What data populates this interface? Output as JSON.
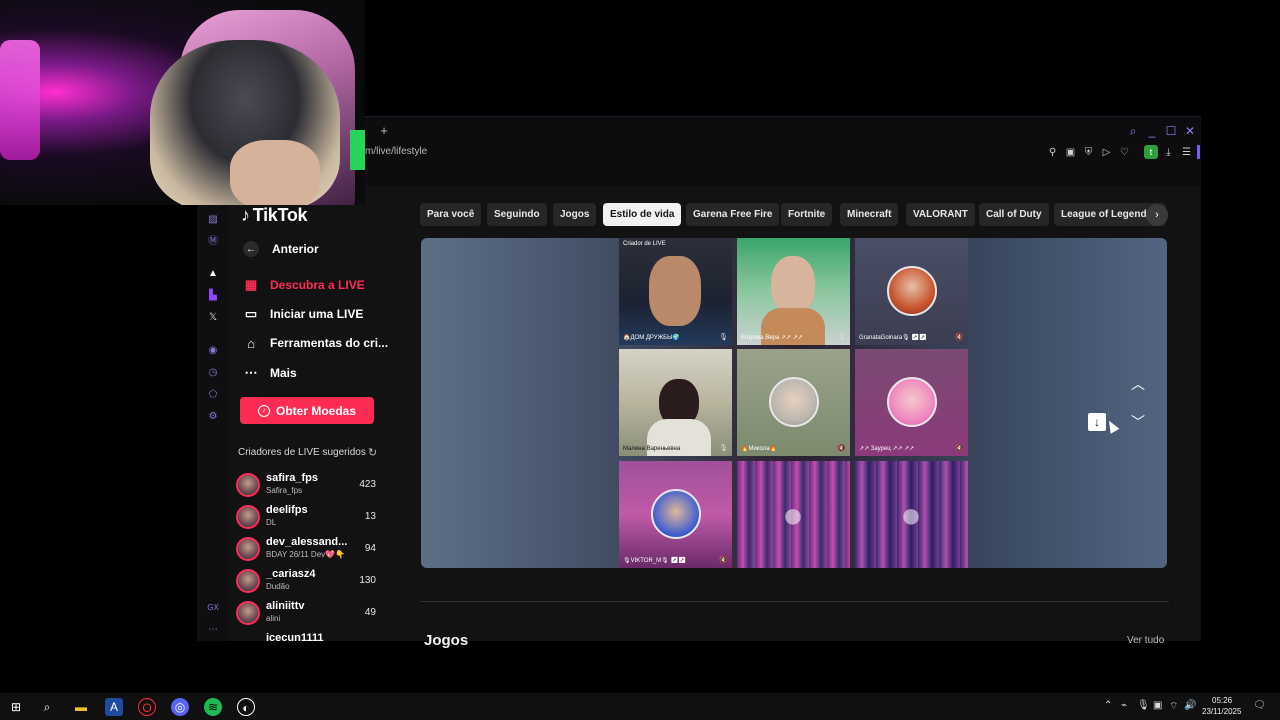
{
  "browser": {
    "url_fragment": "m/live/lifestyle",
    "new_tab": "+",
    "ext_badge": "t"
  },
  "tiktok": {
    "logo": "TikTok",
    "nav": [
      {
        "label": "Anterior",
        "icon": "back-arrow-icon"
      },
      {
        "label": "Descubra a LIVE",
        "icon": "live-tv-icon"
      },
      {
        "label": "Iniciar uma LIVE",
        "icon": "camera-icon"
      },
      {
        "label": "Ferramentas do cri...",
        "icon": "home-tools-icon"
      },
      {
        "label": "Mais",
        "icon": "ellipsis-icon"
      }
    ],
    "coins_button": "Obter Moedas",
    "suggested_title": "Criadores de LIVE sugeridos",
    "creators": [
      {
        "name": "safira_fps",
        "sub": "Safira_fps",
        "count": "423"
      },
      {
        "name": "deelifps",
        "sub": "DL",
        "count": "13"
      },
      {
        "name": "dev_alessand...",
        "sub": "BDAY 26/11 Dev💖👇",
        "count": "94"
      },
      {
        "name": "_cariasz4",
        "sub": "Dudão",
        "count": "130"
      },
      {
        "name": "aliniittv",
        "sub": "alini",
        "count": "49"
      },
      {
        "name": "icecun1111",
        "sub": "",
        "count": ""
      }
    ]
  },
  "categories": [
    "Para você",
    "Seguindo",
    "Jogos",
    "Estilo de vida",
    "Garena Free Fire",
    "Fortnite",
    "Minecraft",
    "VALORANT",
    "Call of Duty",
    "League of Legends"
  ],
  "active_category": "Estilo de vida",
  "player": {
    "host_tag": "Criador de LIVE",
    "tiles": [
      {
        "label": "🏠ДОМ ДРУЖБЫ🌍"
      },
      {
        "label": "Егорова Вера ↗↗ ↗↗"
      },
      {
        "label": "GranataGolnara🎙 ↗↗"
      },
      {
        "label": "Малина Вареньевна"
      },
      {
        "label": "🔥Микола🔥"
      },
      {
        "label": "↗↗ Заурец ↗↗ ↗↗"
      },
      {
        "label": "🎙VIKTOR_M🎙 ↗↗"
      },
      {
        "label": ""
      },
      {
        "label": ""
      }
    ]
  },
  "section": {
    "title": "Jogos",
    "see_all": "Ver tudo"
  },
  "taskbar": {
    "time": "05:26",
    "date": "23/11/2025"
  }
}
